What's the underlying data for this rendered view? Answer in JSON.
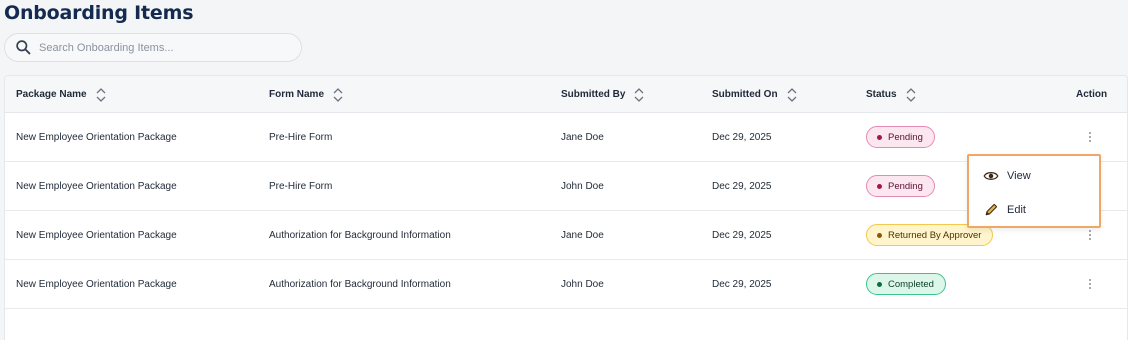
{
  "page": {
    "title": "Onboarding Items"
  },
  "search": {
    "placeholder": "Search Onboarding Items...",
    "icon": "search-icon"
  },
  "table": {
    "columns": [
      {
        "key": "package",
        "label": "Package Name",
        "sortable": true
      },
      {
        "key": "form",
        "label": "Form Name",
        "sortable": true
      },
      {
        "key": "submitted_by",
        "label": "Submitted By",
        "sortable": true
      },
      {
        "key": "submitted_on",
        "label": "Submitted On",
        "sortable": true
      },
      {
        "key": "status",
        "label": "Status",
        "sortable": true
      },
      {
        "key": "action",
        "label": "Action",
        "sortable": false
      }
    ],
    "rows": [
      {
        "package": "New Employee Orientation Package",
        "form": "Pre-Hire Form",
        "submitted_by": "Jane Doe",
        "submitted_on": "Dec 29, 2025",
        "status": "Pending"
      },
      {
        "package": "New Employee Orientation Package",
        "form": "Pre-Hire Form",
        "submitted_by": "John Doe",
        "submitted_on": "Dec 29, 2025",
        "status": "Pending"
      },
      {
        "package": "New Employee Orientation Package",
        "form": "Authorization for Background Information",
        "submitted_by": "Jane Doe",
        "submitted_on": "Dec 29, 2025",
        "status": "Returned By Approver"
      },
      {
        "package": "New Employee Orientation Package",
        "form": "Authorization for Background Information",
        "submitted_by": "John Doe",
        "submitted_on": "Dec 29, 2025",
        "status": "Completed"
      }
    ]
  },
  "status_colors": {
    "Pending": {
      "bg": "#fce7f1",
      "border": "#e58ab5",
      "dot": "#a3174f",
      "text": "#5b1234"
    },
    "Returned By Approver": {
      "bg": "#fff4cc",
      "border": "#f2c94c",
      "dot": "#8a5a00",
      "text": "#4a3400"
    },
    "Completed": {
      "bg": "#dcf7ea",
      "border": "#3cc48a",
      "dot": "#0f6b44",
      "text": "#0f3d29"
    }
  },
  "action_menu": {
    "items": [
      {
        "label": "View",
        "icon": "eye-icon"
      },
      {
        "label": "Edit",
        "icon": "pencil-icon"
      }
    ],
    "highlight_color": "#f0a766"
  },
  "theme": {
    "title_color": "#142a4e",
    "background": "#f4f5f7"
  }
}
